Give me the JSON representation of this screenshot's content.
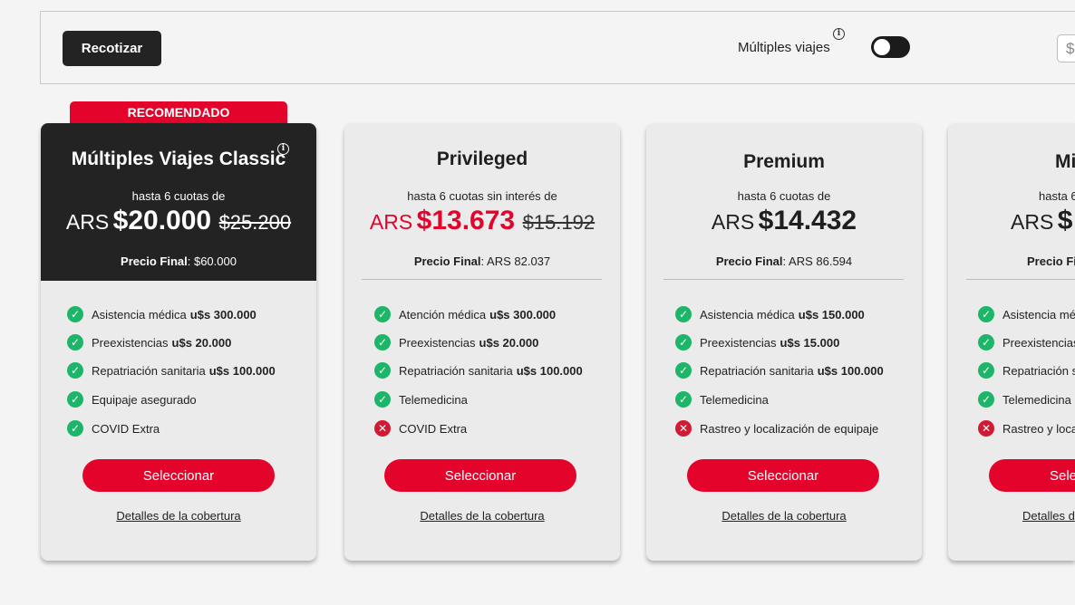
{
  "topbar": {
    "recotizar_label": "Recotizar",
    "multiples_label": "Múltiples viajes",
    "toggle_on": false,
    "currency_symbol": "$"
  },
  "badge": "RECOMENDADO",
  "colors": {
    "accent": "#e4032b",
    "dark": "#232323",
    "check": "#1db669",
    "cross": "#d11b34"
  },
  "cards": [
    {
      "title": "Múltiples Viajes Classic",
      "cuotas": "hasta 6 cuotas de",
      "currency": "ARS",
      "price": "$20.000",
      "old_price": "$25.200",
      "final_label": "Precio Final",
      "final_value": ": $60.000",
      "features": [
        {
          "text": "Asistencia médica",
          "bold": "u$s 300.000",
          "included": true
        },
        {
          "text": "Preexistencias",
          "bold": "u$s 20.000",
          "included": true
        },
        {
          "text": "Repatriación sanitaria",
          "bold": "u$s 100.000",
          "included": true
        },
        {
          "text": "Equipaje asegurado",
          "bold": "",
          "included": true
        },
        {
          "text": "COVID Extra",
          "bold": "",
          "included": true
        }
      ],
      "select_label": "Seleccionar",
      "details_label": "Detalles de la cobertura"
    },
    {
      "title": "Privileged",
      "cuotas": "hasta 6 cuotas sin interés de",
      "currency": "ARS",
      "price": "$13.673",
      "old_price": "$15.192",
      "final_label": "Precio Final",
      "final_value": ": ARS 82.037",
      "features": [
        {
          "text": "Atención médica",
          "bold": "u$s 300.000",
          "included": true
        },
        {
          "text": "Preexistencias",
          "bold": "u$s 20.000",
          "included": true
        },
        {
          "text": "Repatriación sanitaria",
          "bold": "u$s 100.000",
          "included": true
        },
        {
          "text": "Telemedicina",
          "bold": "",
          "included": true
        },
        {
          "text": "COVID Extra",
          "bold": "",
          "included": false
        }
      ],
      "select_label": "Seleccionar",
      "details_label": "Detalles de la cobertura"
    },
    {
      "title": "Premium",
      "cuotas": "hasta 6 cuotas de",
      "currency": "ARS",
      "price": "$14.432",
      "old_price": "",
      "final_label": "Precio Final",
      "final_value": ": ARS 86.594",
      "features": [
        {
          "text": "Asistencia médica",
          "bold": "u$s 150.000",
          "included": true
        },
        {
          "text": "Preexistencias",
          "bold": "u$s 15.000",
          "included": true
        },
        {
          "text": "Repatriación sanitaria",
          "bold": "u$s 100.000",
          "included": true
        },
        {
          "text": "Telemedicina",
          "bold": "",
          "included": true
        },
        {
          "text": "Rastreo y localización de equipaje",
          "bold": "",
          "included": false
        }
      ],
      "select_label": "Seleccionar",
      "details_label": "Detalles de la cobertura"
    },
    {
      "title": "Mi",
      "cuotas": "hasta 6",
      "currency": "ARS",
      "price": "$",
      "old_price": "",
      "final_label": "Precio Fi",
      "final_value": "",
      "features": [
        {
          "text": "Asistencia mé",
          "bold": "",
          "included": true
        },
        {
          "text": "Preexistencias",
          "bold": "",
          "included": true
        },
        {
          "text": "Repatriación s",
          "bold": "",
          "included": true
        },
        {
          "text": "Telemedicina",
          "bold": "",
          "included": true
        },
        {
          "text": "Rastreo y loca",
          "bold": "",
          "included": false
        }
      ],
      "select_label": "Sele",
      "details_label": "Detalles d"
    }
  ]
}
